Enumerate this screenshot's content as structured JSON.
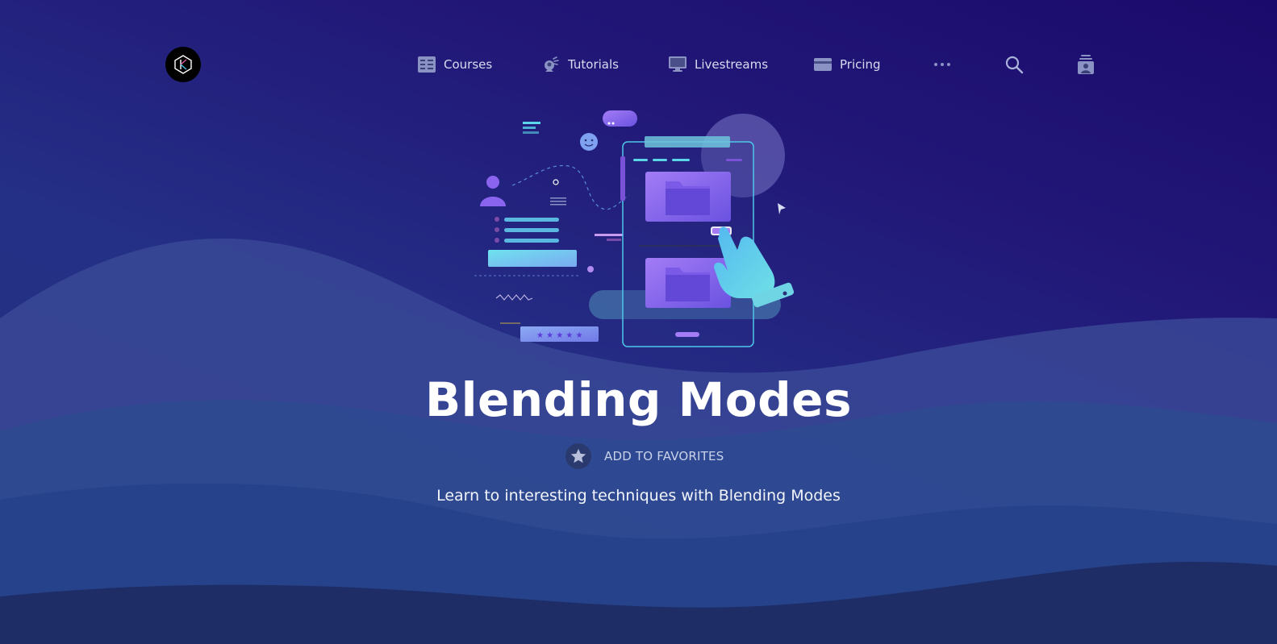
{
  "nav": {
    "logo_icon": "kodeco-logo-icon",
    "items": [
      {
        "label": "Courses",
        "icon": "courses-icon"
      },
      {
        "label": "Tutorials",
        "icon": "tutorials-icon"
      },
      {
        "label": "Livestreams",
        "icon": "livestreams-icon"
      },
      {
        "label": "Pricing",
        "icon": "pricing-icon"
      }
    ],
    "more_icon": "more-dots-icon",
    "search_icon": "search-icon",
    "account_icon": "account-icon"
  },
  "hero": {
    "illustration": "mobile-app-interaction-illustration",
    "title": "Blending Modes",
    "favorite_label": "ADD TO FAVORITES",
    "favorite_icon": "star-icon",
    "subtitle": "Learn to interesting techniques with Blending Modes"
  },
  "colors": {
    "background_top": "#1a0a6b",
    "background_bottom": "#20307a",
    "wave_light": "#3a4a98",
    "wave_mid": "#2b4a8c",
    "accent_cyan": "#5ad6e8",
    "accent_purple": "#8a5cf0"
  }
}
